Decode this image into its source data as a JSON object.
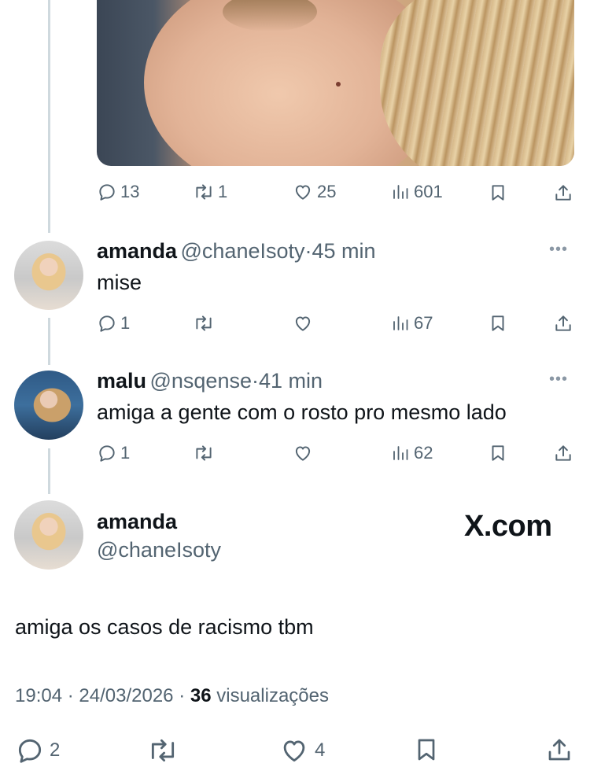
{
  "post_top": {
    "replies": "13",
    "reposts": "1",
    "likes": "25",
    "views": "601"
  },
  "reply1": {
    "name": "amanda",
    "handle": "@chaneIsoty",
    "sep": "·",
    "time": "45 min",
    "text": "mise",
    "replies": "1",
    "views": "67"
  },
  "reply2": {
    "name": "malu",
    "handle": "@nsqense",
    "sep": "·",
    "time": "41 min",
    "text": "amiga a gente com o rosto pro mesmo lado",
    "replies": "1",
    "views": "62"
  },
  "main": {
    "name": "amanda",
    "handle": "@chaneIsoty",
    "brand": "X.com",
    "text": "amiga os casos de racismo tbm",
    "time": "19:04",
    "sep": "·",
    "date": "24/03/2026",
    "views_count": "36",
    "views_label": "visualizações",
    "replies": "2",
    "likes": "4"
  },
  "icons": {
    "reply": "reply-icon",
    "repost": "repost-icon",
    "like": "heart-icon",
    "views": "views-icon",
    "bookmark": "bookmark-icon",
    "share": "share-icon",
    "more": "more-icon"
  }
}
